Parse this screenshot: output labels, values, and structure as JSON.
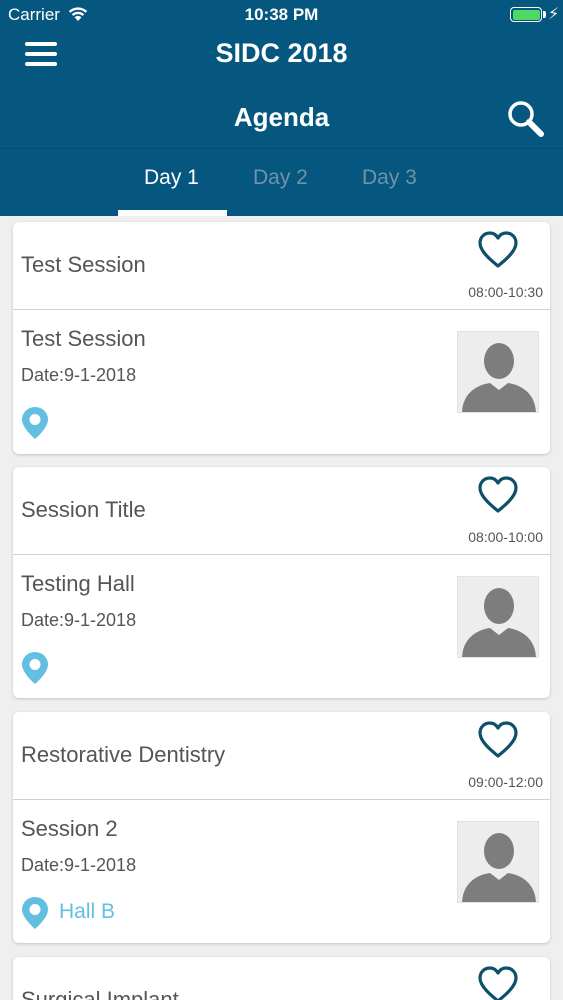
{
  "status_bar": {
    "carrier": "Carrier",
    "time": "10:38 PM"
  },
  "header": {
    "app_title": "SIDC 2018",
    "page_title": "Agenda",
    "menu_icon": "hamburger-menu-icon",
    "search_icon": "search-icon"
  },
  "tabs": [
    {
      "label": "Day 1",
      "active": true
    },
    {
      "label": "Day 2",
      "active": false
    },
    {
      "label": "Day 3",
      "active": false
    }
  ],
  "sessions": [
    {
      "title": "Test Session",
      "time": "08:00-10:30",
      "speaker": "Test Session",
      "date": "Date:9-1-2018",
      "location": ""
    },
    {
      "title": "Session Title",
      "time": "08:00-10:00",
      "speaker": "Testing Hall",
      "date": "Date:9-1-2018",
      "location": ""
    },
    {
      "title": "Restorative Dentistry",
      "time": "09:00-12:00",
      "speaker": "Session 2",
      "date": "Date:9-1-2018",
      "location": "Hall B"
    },
    {
      "title": "Surgical Implant"
    }
  ],
  "colors": {
    "header_bg": "#06577f",
    "pin": "#62bfe0",
    "heart": "#0e4f6a",
    "battery": "#4cd964"
  }
}
